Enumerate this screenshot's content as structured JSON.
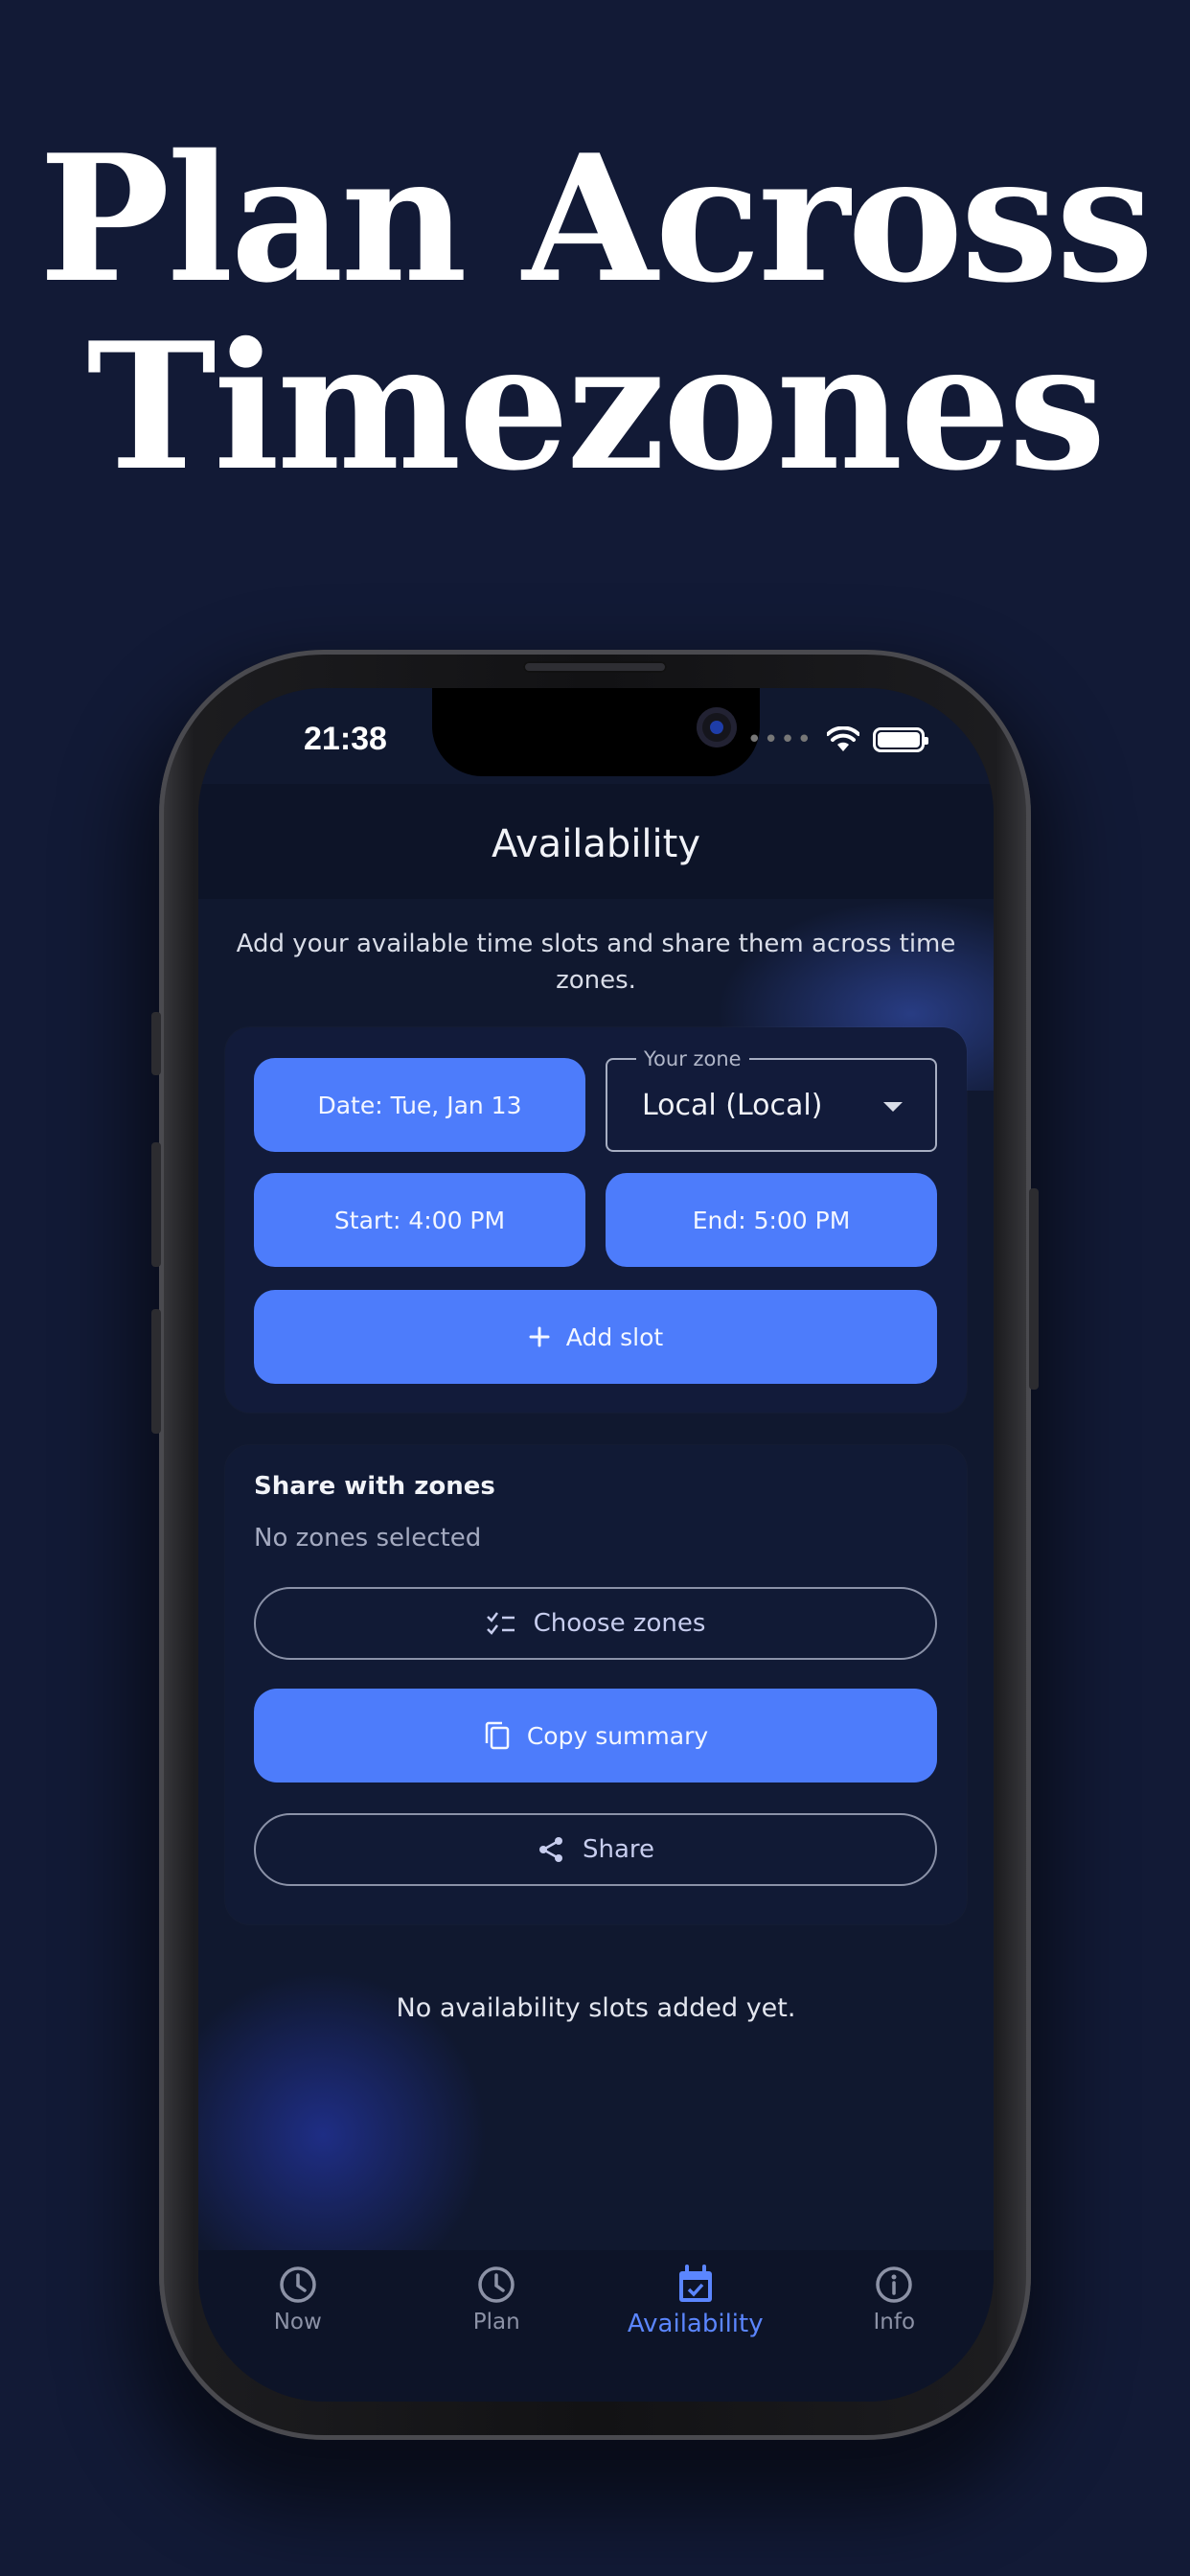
{
  "hero": {
    "line1": "Plan Across",
    "line2": "Timezones"
  },
  "status_bar": {
    "time": "21:38"
  },
  "app": {
    "title": "Availability",
    "intro": "Add your available time slots and share them across time zones."
  },
  "slot_form": {
    "date_button": "Date: Tue, Jan 13",
    "zone_label": "Your zone",
    "zone_value": "Local (Local)",
    "start_button": "Start: 4:00 PM",
    "end_button": "End: 5:00 PM",
    "add_slot_button": "Add slot"
  },
  "share": {
    "heading": "Share with zones",
    "status": "No zones selected",
    "choose_zones_button": "Choose zones",
    "copy_summary_button": "Copy summary",
    "share_button": "Share"
  },
  "empty_state": "No availability slots added yet.",
  "bottom_nav": [
    {
      "label": "Now",
      "icon": "clock-icon"
    },
    {
      "label": "Plan",
      "icon": "clock-icon"
    },
    {
      "label": "Availability",
      "icon": "calendar-check-icon",
      "active": true
    },
    {
      "label": "Info",
      "icon": "info-icon"
    }
  ],
  "colors": {
    "background": "#121a36",
    "accent": "#4d7cfb",
    "active_nav": "#5b86ff"
  }
}
